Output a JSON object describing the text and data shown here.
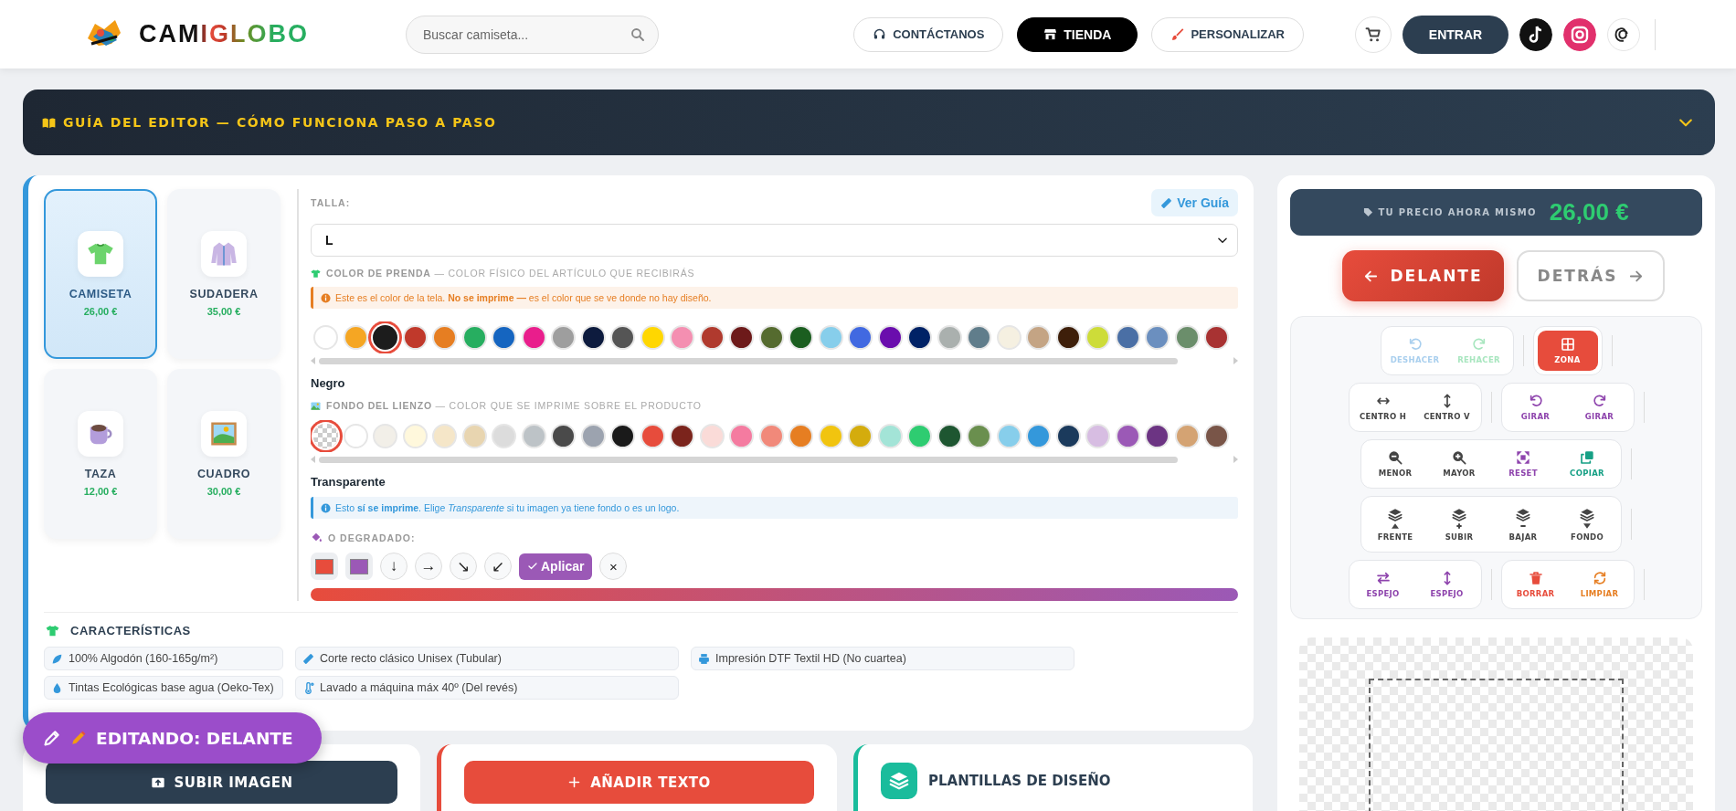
{
  "header": {
    "logo_text": "CAMIGLOBO",
    "search": {
      "placeholder": "Buscar camiseta..."
    },
    "nav": [
      {
        "kind": "contact",
        "label": "CONTÁCTANOS",
        "selected": false
      },
      {
        "kind": "store",
        "label": "TIENDA",
        "selected": true
      },
      {
        "kind": "customize",
        "label": "PERSONALIZAR",
        "selected": false
      }
    ],
    "login_button": "ENTRAR"
  },
  "guide": {
    "title": "GUÍA DEL EDITOR — CÓMO FUNCIONA PASO A PASO",
    "expanded": false
  },
  "products": [
    {
      "kind": "tshirt",
      "name": "CAMISETA",
      "price": "26,00 €",
      "selected": true
    },
    {
      "kind": "hoodie",
      "name": "SUDADERA",
      "price": "35,00 €",
      "selected": false
    },
    {
      "kind": "mug",
      "name": "TAZA",
      "price": "12,00 €",
      "selected": false
    },
    {
      "kind": "frame",
      "name": "CUADRO",
      "price": "30,00 €",
      "selected": false
    }
  ],
  "size": {
    "label": "TALLA:",
    "guide_button": "Ver Guía",
    "value": "L"
  },
  "garment_color": {
    "heading": "**COLOR DE PRENDA** — COLOR FÍSICO DEL ARTÍCULO QUE RECIBIRÁS",
    "note": "Este es el color de la tela. **No se imprime —** es el color que se ve donde no hay diseño.",
    "swatches": [
      {
        "color": "#ffffff",
        "selected": false
      },
      {
        "color": "#f5a623",
        "selected": false
      },
      {
        "color": "#1c1c1c",
        "selected": true
      },
      {
        "color": "#c0392b",
        "selected": false
      },
      {
        "color": "#e67e22",
        "selected": false
      },
      {
        "color": "#27ae60",
        "selected": false
      },
      {
        "color": "#1565c0",
        "selected": false
      },
      {
        "color": "#e91e8c",
        "selected": false
      },
      {
        "color": "#9e9e9e",
        "selected": false
      },
      {
        "color": "#0d1b3e",
        "selected": false
      },
      {
        "color": "#555555",
        "selected": false
      },
      {
        "color": "#ffd700",
        "selected": false
      },
      {
        "color": "#f48fb1",
        "selected": false
      },
      {
        "color": "#b03a2e",
        "selected": false
      },
      {
        "color": "#6d1a1a",
        "selected": false
      },
      {
        "color": "#556b2f",
        "selected": false
      },
      {
        "color": "#1b5e20",
        "selected": false
      },
      {
        "color": "#87ceeb",
        "selected": false
      },
      {
        "color": "#4169e1",
        "selected": false
      },
      {
        "color": "#6a0dad",
        "selected": false
      },
      {
        "color": "#002266",
        "selected": false
      },
      {
        "color": "#aab0ae",
        "selected": false
      },
      {
        "color": "#607d8b",
        "selected": false
      },
      {
        "color": "#f5f0e1",
        "selected": false
      },
      {
        "color": "#c4a484",
        "selected": false
      },
      {
        "color": "#3e1f0a",
        "selected": false
      },
      {
        "color": "#cddc39",
        "selected": false
      },
      {
        "color": "#4a6fa5",
        "selected": false
      },
      {
        "color": "#6b8fbf",
        "selected": false
      },
      {
        "color": "#6b8e6b",
        "selected": false
      },
      {
        "color": "#a83232",
        "selected": false
      }
    ],
    "selected_name": "Negro"
  },
  "canvas_background": {
    "heading": "**FONDO DEL LIENZO** — COLOR QUE SE IMPRIME SOBRE EL PRODUCTO",
    "swatches": [
      {
        "kind": "transparent",
        "selected": true
      },
      {
        "kind": "color",
        "color": "#ffffff",
        "selected": false
      },
      {
        "kind": "color",
        "color": "#f2efe8",
        "selected": false
      },
      {
        "kind": "color",
        "color": "#fff8dc",
        "selected": false
      },
      {
        "kind": "color",
        "color": "#f5e6c8",
        "selected": false
      },
      {
        "kind": "color",
        "color": "#e8d5b0",
        "selected": false
      },
      {
        "kind": "color",
        "color": "#dcdcdc",
        "selected": false
      },
      {
        "kind": "color",
        "color": "#bdc3c7",
        "selected": false
      },
      {
        "kind": "color",
        "color": "#4a4a4a",
        "selected": false
      },
      {
        "kind": "color",
        "color": "#9ca3af",
        "selected": false
      },
      {
        "kind": "color",
        "color": "#1a1a1a",
        "selected": false
      },
      {
        "kind": "color",
        "color": "#e74c3c",
        "selected": false
      },
      {
        "kind": "color",
        "color": "#7b241c",
        "selected": false
      },
      {
        "kind": "color",
        "color": "#fadbd8",
        "selected": false
      },
      {
        "kind": "color",
        "color": "#f47ba0",
        "selected": false
      },
      {
        "kind": "color",
        "color": "#f1897a",
        "selected": false
      },
      {
        "kind": "color",
        "color": "#e67e22",
        "selected": false
      },
      {
        "kind": "color",
        "color": "#f1c40f",
        "selected": false
      },
      {
        "kind": "color",
        "color": "#d4ac0d",
        "selected": false
      },
      {
        "kind": "color",
        "color": "#a3e4d7",
        "selected": false
      },
      {
        "kind": "color",
        "color": "#2ecc71",
        "selected": false
      },
      {
        "kind": "color",
        "color": "#1e5631",
        "selected": false
      },
      {
        "kind": "color",
        "color": "#6a8f4e",
        "selected": false
      },
      {
        "kind": "color",
        "color": "#87ceeb",
        "selected": false
      },
      {
        "kind": "color",
        "color": "#3498db",
        "selected": false
      },
      {
        "kind": "color",
        "color": "#1b3a5c",
        "selected": false
      },
      {
        "kind": "color",
        "color": "#d7bde2",
        "selected": false
      },
      {
        "kind": "color",
        "color": "#9b59b6",
        "selected": false
      },
      {
        "kind": "color",
        "color": "#6c3483",
        "selected": false
      },
      {
        "kind": "color",
        "color": "#d4a373",
        "selected": false
      },
      {
        "kind": "color",
        "color": "#795548",
        "selected": false
      }
    ],
    "selected_name": "Transparente",
    "note": "Esto **sí se imprime**. Elige *Transparente* si tu imagen ya tiene fondo o es un logo."
  },
  "gradient": {
    "label": "O DEGRADADO:",
    "stops": [
      {
        "color": "#e74c3c"
      },
      {
        "color": "#9b59b6"
      }
    ],
    "directions": [
      "↓",
      "→",
      "↘",
      "↙"
    ],
    "apply_button": "Aplicar",
    "clear_button": "×"
  },
  "features": {
    "title": "CARACTERÍSTICAS",
    "items": [
      {
        "kind": "leaf",
        "text": "100% Algodón (160-165g/m²)"
      },
      {
        "kind": "ruler",
        "text": "Corte recto clásico Unisex (Tubular)"
      },
      {
        "kind": "printer",
        "text": "Impresión DTF Textil HD (No cuartea)"
      },
      {
        "kind": "drop",
        "text": "Tintas Ecológicas base agua (Oeko-Tex)"
      },
      {
        "kind": "thermometer",
        "text": "Lavado a máquina máx 40º (Del revés)"
      }
    ]
  },
  "price_bar": {
    "label": "TU PRECIO AHORA MISMO",
    "price": "26,00 €"
  },
  "sides": [
    {
      "kind": "front",
      "label": "DELANTE",
      "selected": true
    },
    {
      "kind": "back",
      "label": "DETRÁS",
      "selected": false
    }
  ],
  "tools": [
    [
      [
        {
          "kind": "undo",
          "label": "DESHACER",
          "color": "#a9cfee",
          "active": false
        },
        {
          "kind": "redo",
          "label": "REHACER",
          "color": "#a8e6bf",
          "active": false
        }
      ],
      [
        {
          "kind": "zone",
          "label": "ZONA",
          "color": "#e74c3c",
          "active": true
        }
      ]
    ],
    [
      [
        {
          "kind": "center-h",
          "label": "CENTRO H",
          "color": "#444444",
          "active": false
        },
        {
          "kind": "center-v",
          "label": "CENTRO V",
          "color": "#444444",
          "active": false
        }
      ],
      [
        {
          "kind": "rotate-left",
          "label": "GIRAR",
          "color": "#8e44ad",
          "active": false
        },
        {
          "kind": "rotate-right",
          "label": "GIRAR",
          "color": "#8e44ad",
          "active": false
        }
      ]
    ],
    [
      [
        {
          "kind": "zoom-out",
          "label": "MENOR",
          "color": "#444444",
          "active": false
        },
        {
          "kind": "zoom-in",
          "label": "MAYOR",
          "color": "#444444",
          "active": false
        },
        {
          "kind": "reset",
          "label": "RESET",
          "color": "#8e44ad",
          "active": false
        },
        {
          "kind": "copy",
          "label": "COPIAR",
          "color": "#16a085",
          "active": false
        }
      ]
    ],
    [
      [
        {
          "kind": "front",
          "label": "FRENTE",
          "color": "#444444",
          "active": false
        },
        {
          "kind": "forward",
          "label": "SUBIR",
          "color": "#444444",
          "active": false
        },
        {
          "kind": "backward",
          "label": "BAJAR",
          "color": "#444444",
          "active": false
        },
        {
          "kind": "back",
          "label": "FONDO",
          "color": "#444444",
          "active": false
        }
      ]
    ],
    [
      [
        {
          "kind": "mirror-h",
          "label": "ESPEJO",
          "color": "#8e44ad",
          "active": false
        },
        {
          "kind": "mirror-v",
          "label": "ESPEJO",
          "color": "#8e44ad",
          "active": false
        }
      ],
      [
        {
          "kind": "delete",
          "label": "BORRAR",
          "color": "#e74c3c",
          "active": false
        },
        {
          "kind": "clear",
          "label": "LIMPIAR",
          "color": "#e67e22",
          "active": false
        }
      ]
    ]
  ],
  "bottom": {
    "upload_button": "SUBIR IMAGEN",
    "add_text_button": "AÑADIR TEXTO",
    "templates_title": "PLANTILLAS DE DISEÑO"
  },
  "editing_badge": "EDITANDO: DELANTE"
}
